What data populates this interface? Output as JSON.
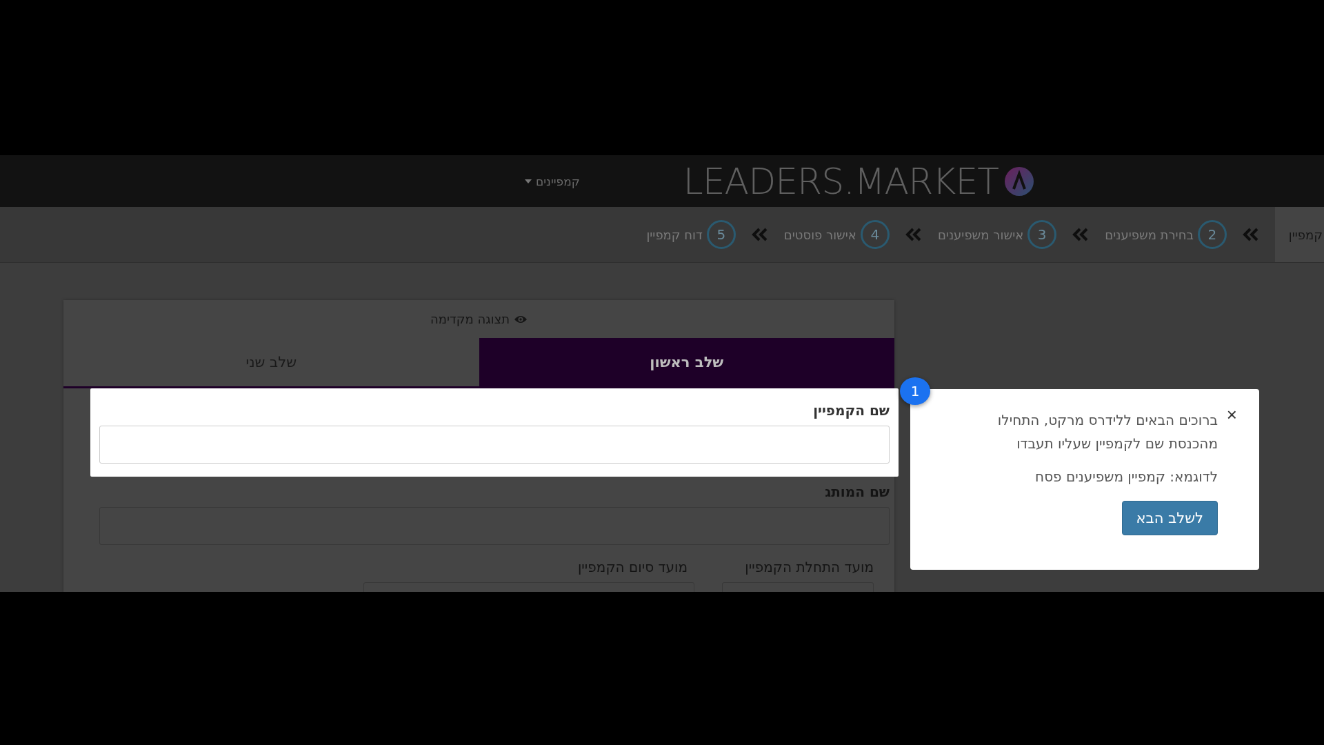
{
  "header": {
    "logo": "LEADERS.MARKET",
    "menu": "קמפיינים"
  },
  "steps": [
    {
      "label": "קמפיין",
      "selected": true
    },
    {
      "number": "2",
      "label": "בחירת משפיענים",
      "selected": false
    },
    {
      "number": "3",
      "label": "אישור משפיענים",
      "selected": false
    },
    {
      "number": "4",
      "label": "אישור פוסטים",
      "selected": false
    },
    {
      "number": "5",
      "label": "דוח קמפיין",
      "selected": false
    }
  ],
  "card": {
    "preview": "תצוגה מקדימה",
    "tabs": [
      {
        "label": "שלב ראשון",
        "selected": true
      },
      {
        "label": "שלב שני",
        "selected": false
      }
    ],
    "campaign_name": {
      "label": "שם הקמפיין"
    },
    "brand_name": {
      "label": "שם המותג"
    },
    "dates": [
      {
        "label": "מועד התחלת הקמפיין"
      },
      {
        "label": "מועד סיום הקמפיין"
      }
    ]
  },
  "tour": {
    "badge": "1",
    "close": "×",
    "text": [
      "ברוכים הבאים ללידרס מרקט, התחילו מהכנסת שם לקמפיין שעליו תעבדו",
      "לדוגמא: קמפיין משפיענים פסח"
    ],
    "button": "לשלב הבא"
  }
}
